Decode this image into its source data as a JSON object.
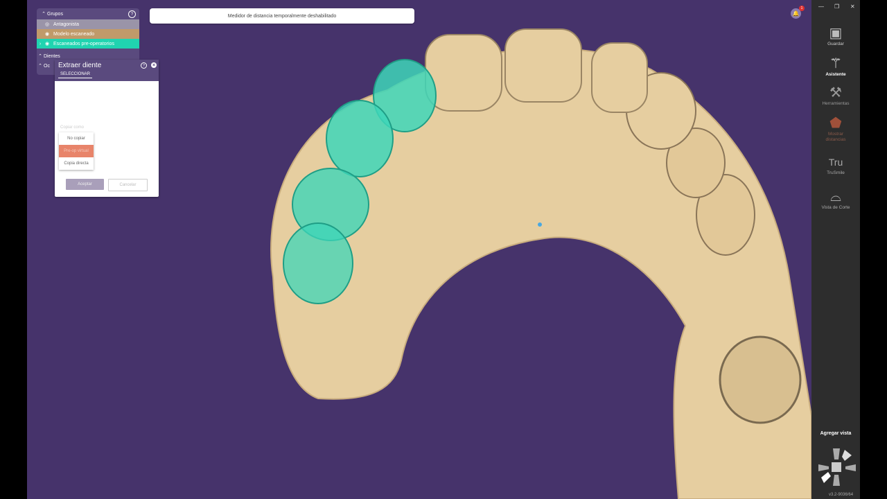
{
  "notice": {
    "text": "Medidor de distancia temporalmente deshabilitado"
  },
  "groups": {
    "title": "Grupos",
    "items": [
      {
        "label": "Antagonista",
        "bg": "#9a94a8"
      },
      {
        "label": "Modelo escaneado",
        "bg": "#c09a6a"
      },
      {
        "label": "Escaneados pre-operatorios",
        "bg": "#20d4b0"
      }
    ],
    "row_dientes": "Dientes",
    "row_oc": "Oc"
  },
  "extract": {
    "title": "Extraer diente",
    "tab": "SELECCIONAR",
    "copy_label": "Copiar como",
    "options": [
      "No copiar",
      "Pre-op virtual",
      "Copia directa"
    ],
    "accept": "Aceptar",
    "cancel": "Cancelar"
  },
  "notifications": {
    "count": "1"
  },
  "sidebar": {
    "items": [
      {
        "label": "Guardar",
        "icon": "save-icon",
        "glyph": "💾"
      },
      {
        "label": "Asistente",
        "icon": "magic-wand-icon",
        "glyph": "✨"
      },
      {
        "label": "Herramientas",
        "icon": "tools-icon",
        "glyph": "🛠"
      },
      {
        "label": "Mostrar distancias",
        "icon": "tooth-distance-icon",
        "glyph": "⬤"
      },
      {
        "label": "TruSmile",
        "icon": "trusmile-icon",
        "glyph": "Tru"
      },
      {
        "label": "Vista de Corte",
        "icon": "tooth-cut-icon",
        "glyph": "⌓"
      }
    ],
    "add_view": "Agregar vista"
  },
  "version": "v3.2-9036/64",
  "colors": {
    "viewport": "#46336b",
    "model": "#e6cea0",
    "preop": "#3ed6b8",
    "accent": "#e8846a"
  }
}
